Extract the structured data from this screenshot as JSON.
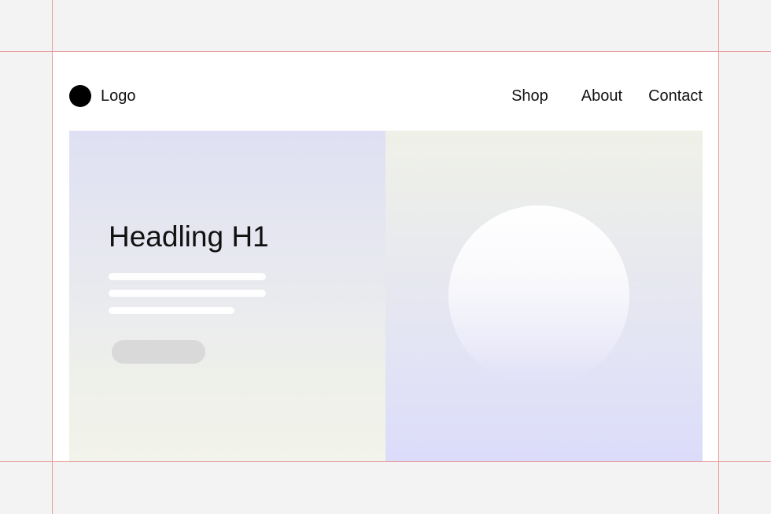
{
  "header": {
    "logo_label": "Logo",
    "nav": [
      {
        "label": "Shop"
      },
      {
        "label": "About"
      },
      {
        "label": "Contact"
      }
    ]
  },
  "hero": {
    "headline": "Headling H1"
  },
  "colors": {
    "page_background": "#f3f3f3",
    "frame_background": "#ffffff",
    "guide_line": "#e79a9a",
    "logo_dot": "#000000",
    "button_placeholder": "#d9d9d9",
    "left_panel_top": "#dfe0f3",
    "left_panel_bottom": "#f2f3ea",
    "right_panel_top": "#eff1e8",
    "right_panel_bottom": "#dcdcfa"
  }
}
